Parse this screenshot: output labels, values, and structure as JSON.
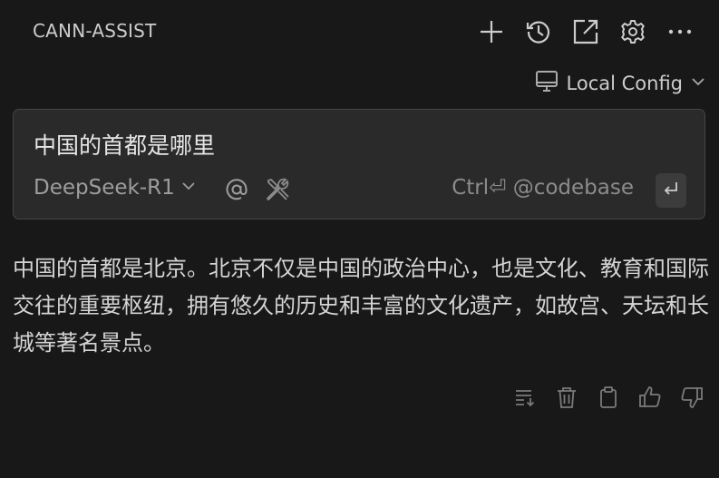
{
  "header": {
    "title": "CANN-ASSIST",
    "actions": [
      {
        "icon": "plus-icon"
      },
      {
        "icon": "history-icon"
      },
      {
        "icon": "open-external-icon"
      },
      {
        "icon": "gear-icon"
      },
      {
        "icon": "more-icon"
      }
    ]
  },
  "config": {
    "icon": "monitor-icon",
    "label": "Local Config"
  },
  "input": {
    "value": "中国的首都是哪里",
    "model": "DeepSeek-R1",
    "hint": "Ctrl⏎ @codebase",
    "send_icon": "enter-icon"
  },
  "answer": {
    "text": "中国的首都是北京。北京不仅是中国的政治中心，也是文化、教育和国际交往的重要枢纽，拥有悠久的历史和丰富的文化遗产，如故宫、天坛和长城等著名景点。"
  },
  "message_actions": [
    {
      "icon": "insert-icon"
    },
    {
      "icon": "trash-icon"
    },
    {
      "icon": "clipboard-icon"
    },
    {
      "icon": "thumbs-up-icon"
    },
    {
      "icon": "thumbs-down-icon"
    }
  ],
  "colors": {
    "background": "#181818",
    "input_background": "#2a2a2a",
    "border": "#454545",
    "text": "#cccccc",
    "muted": "#8c8c8c"
  }
}
